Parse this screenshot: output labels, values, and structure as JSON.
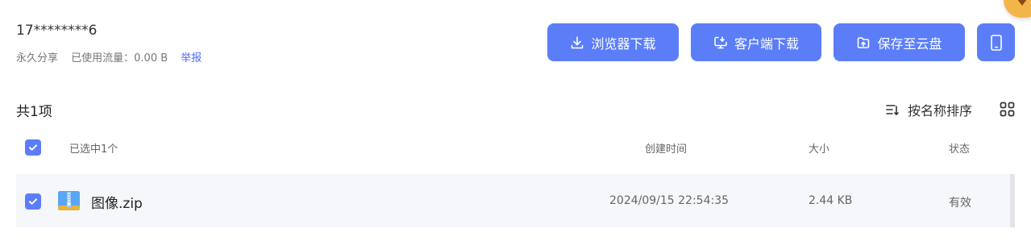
{
  "share": {
    "user": "17********6",
    "permanence": "永久分享",
    "traffic_label": "已使用流量：0.00 B",
    "report": "举报"
  },
  "actions": {
    "browser_download": "浏览器下载",
    "client_download": "客户端下载",
    "save_to_cloud": "保存至云盘",
    "phone_icon": "mobile-phone-icon"
  },
  "list": {
    "count": "共1项",
    "sort": "按名称排序",
    "view_icon": "grid-view-icon",
    "header": {
      "selected": "已选中1个",
      "created": "创建时间",
      "size": "大小",
      "status": "状态"
    },
    "files": [
      {
        "name": "图像.zip",
        "created": "2024/09/15 22:54:35",
        "size": "2.44 KB",
        "status": "有效",
        "icon": "zip-file-icon",
        "checked": true
      }
    ]
  },
  "colors": {
    "accent": "#5b7ef8",
    "link": "#4f6ef7",
    "row_bg": "#f6f7fa"
  }
}
